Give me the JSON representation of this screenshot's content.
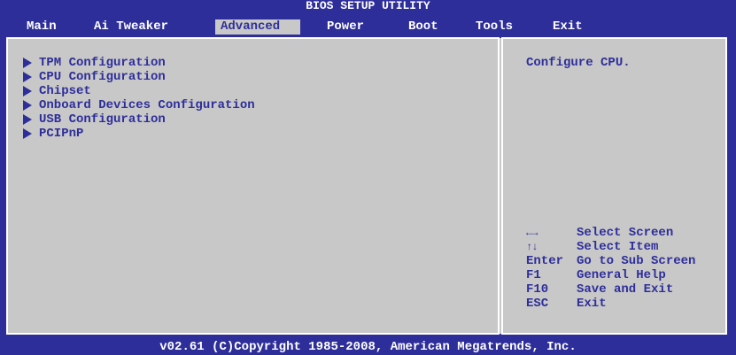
{
  "title": "BIOS SETUP UTILITY",
  "menu": [
    {
      "label": "Main"
    },
    {
      "label": "Ai Tweaker"
    },
    {
      "label": "Advanced"
    },
    {
      "label": "Power"
    },
    {
      "label": "Boot"
    },
    {
      "label": "Tools"
    },
    {
      "label": "Exit"
    }
  ],
  "active_menu": "Advanced",
  "items": [
    {
      "label": "TPM Configuration"
    },
    {
      "label": "CPU Configuration"
    },
    {
      "label": "Chipset"
    },
    {
      "label": "Onboard Devices Configuration"
    },
    {
      "label": "USB Configuration"
    },
    {
      "label": "PCIPnP"
    }
  ],
  "help": {
    "text": "Configure CPU."
  },
  "keys": [
    {
      "key": "←→",
      "desc": "Select Screen",
      "icon": "left-right-arrows-icon"
    },
    {
      "key": "↑↓",
      "desc": "Select Item",
      "icon": "up-down-arrows-icon"
    },
    {
      "key": "Enter",
      "desc": "Go to Sub Screen"
    },
    {
      "key": "F1",
      "desc": "General Help"
    },
    {
      "key": "F10",
      "desc": "Save and Exit"
    },
    {
      "key": "ESC",
      "desc": "Exit"
    }
  ],
  "footer": "v02.61 (C)Copyright 1985-2008, American Megatrends, Inc.",
  "colors": {
    "background": "#2e2e9a",
    "panel": "#c8c8c8",
    "text": "#2e2e9a",
    "title_text": "#ffffff"
  }
}
